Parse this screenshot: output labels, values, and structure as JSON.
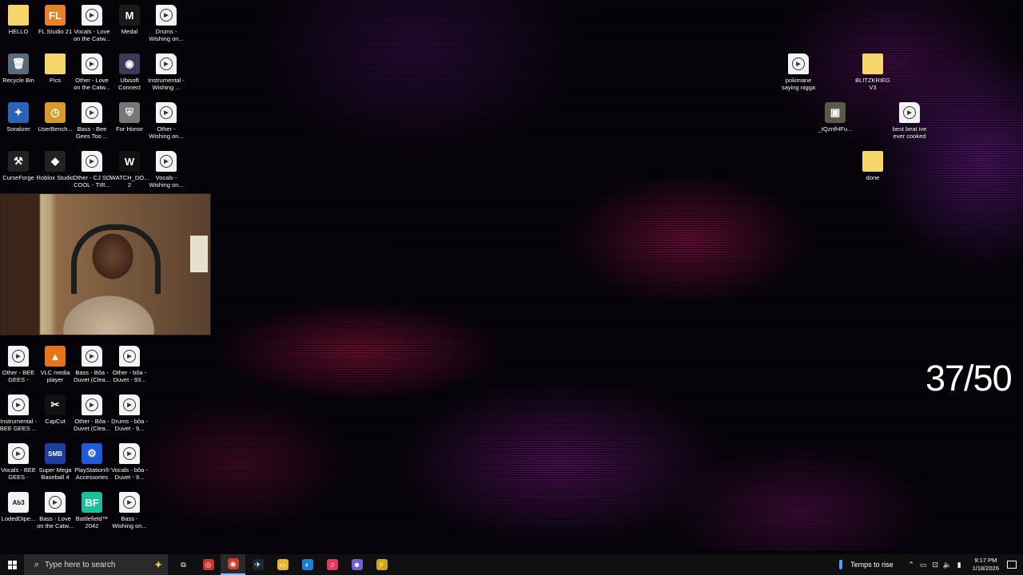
{
  "desktop_icons": [
    {
      "label": "HELLO",
      "kind": "folder",
      "icon": "folder-icon",
      "glyph": ""
    },
    {
      "label": "FL Studio 21",
      "kind": "app",
      "icon": "fl-studio-icon",
      "glyph": "FL",
      "color": "#e8822a"
    },
    {
      "label": "Vocals - Love on the Catw...",
      "kind": "media",
      "icon": "media-file-icon",
      "glyph": "▶"
    },
    {
      "label": "Medal",
      "kind": "app",
      "icon": "medal-icon",
      "glyph": "M",
      "color": "#1a1a1a"
    },
    {
      "label": "Drums - Wishing on...",
      "kind": "media",
      "icon": "media-file-icon",
      "glyph": "▶"
    },
    {
      "label": "Recycle Bin",
      "kind": "app",
      "icon": "recycle-bin-icon",
      "glyph": "🗑",
      "color": "#5a6b7d"
    },
    {
      "label": "Pics",
      "kind": "folder",
      "icon": "folder-icon",
      "glyph": ""
    },
    {
      "label": "Other - Love on the Catw...",
      "kind": "media",
      "icon": "media-file-icon",
      "glyph": "▶"
    },
    {
      "label": "Ubisoft Connect",
      "kind": "app",
      "icon": "ubisoft-icon",
      "glyph": "◉",
      "color": "#3a3a5a"
    },
    {
      "label": "Instrumental - Wishing ...",
      "kind": "media",
      "icon": "media-file-icon",
      "glyph": "▶"
    },
    {
      "label": "Soralizer",
      "kind": "app",
      "icon": "soralizer-icon",
      "glyph": "✦",
      "color": "#2a63b8"
    },
    {
      "label": "UserBench...",
      "kind": "app",
      "icon": "userbenchmark-icon",
      "glyph": "◷",
      "color": "#d89a2b"
    },
    {
      "label": "Bass - Bee Gees Too ...",
      "kind": "media",
      "icon": "media-file-icon",
      "glyph": "▶"
    },
    {
      "label": "For Honor",
      "kind": "app",
      "icon": "for-honor-icon",
      "glyph": "⛨",
      "color": "#777"
    },
    {
      "label": "Other - Wishing on...",
      "kind": "media",
      "icon": "media-file-icon",
      "glyph": "▶"
    },
    {
      "label": "CurseForge",
      "kind": "app",
      "icon": "curseforge-icon",
      "glyph": "⚒",
      "color": "#222"
    },
    {
      "label": "Roblox Studio",
      "kind": "app",
      "icon": "roblox-studio-icon",
      "glyph": "◆",
      "color": "#222"
    },
    {
      "label": "Other - CJ SO COOL - TIR...",
      "kind": "media",
      "icon": "media-file-icon",
      "glyph": "▶"
    },
    {
      "label": "WATCH_DO... 2",
      "kind": "app",
      "icon": "watch-dogs-icon",
      "glyph": "W",
      "color": "#111"
    },
    {
      "label": "Vocals - Wishing on...",
      "kind": "media",
      "icon": "media-file-icon",
      "glyph": "▶"
    },
    {
      "label": "Other - BEE GEES - TOO...",
      "kind": "media",
      "icon": "media-file-icon",
      "glyph": "▶"
    },
    {
      "label": "VLC media player",
      "kind": "app",
      "icon": "vlc-icon",
      "glyph": "▲",
      "color": "#e8741a"
    },
    {
      "label": "Bass - Bôa - Duvet (Clea...",
      "kind": "media",
      "icon": "media-file-icon",
      "glyph": "▶"
    },
    {
      "label": "Other - bôa - Duvet - 93...",
      "kind": "media",
      "icon": "media-file-icon",
      "glyph": "▶"
    },
    {
      "label": "Instrumental - BEE GEES ...",
      "kind": "media",
      "icon": "media-file-icon",
      "glyph": "▶"
    },
    {
      "label": "CapCut",
      "kind": "app",
      "icon": "capcut-icon",
      "glyph": "✂",
      "color": "#111"
    },
    {
      "label": "Other - Bôa - Duvet (Clea...",
      "kind": "media",
      "icon": "media-file-icon",
      "glyph": "▶"
    },
    {
      "label": "Drums - bôa - Duvet - 9...",
      "kind": "media",
      "icon": "media-file-icon",
      "glyph": "▶"
    },
    {
      "label": "Vocals - BEE GEES - TOO...",
      "kind": "media",
      "icon": "media-file-icon",
      "glyph": "▶"
    },
    {
      "label": "Super Mega Baseball 4",
      "kind": "app",
      "icon": "super-mega-baseball-icon",
      "glyph": "SMB",
      "color": "#1c3fa0"
    },
    {
      "label": "PlayStation® Accessories",
      "kind": "app",
      "icon": "playstation-icon",
      "glyph": "⚙",
      "color": "#1f5bd8"
    },
    {
      "label": "Vocals - bôa - Duvet - 9...",
      "kind": "media",
      "icon": "media-file-icon",
      "glyph": "▶"
    },
    {
      "label": "LodedDipe...",
      "kind": "app",
      "icon": "ableton-icon",
      "glyph": "Ab3",
      "color": "#f2f2f2"
    },
    {
      "label": "Bass - Love on the Catw...",
      "kind": "media",
      "icon": "media-file-icon",
      "glyph": "▶"
    },
    {
      "label": "Battlefield™ 2042",
      "kind": "app",
      "icon": "battlefield-icon",
      "glyph": "BF",
      "color": "#1bbf9a"
    },
    {
      "label": "Bass - Wishing on...",
      "kind": "media",
      "icon": "media-file-icon",
      "glyph": "▶"
    },
    {
      "label": "pokimane saying nigga",
      "kind": "media",
      "icon": "media-file-icon",
      "glyph": "▶"
    },
    {
      "label": "BLITZKRIEG V3",
      "kind": "folder",
      "icon": "folder-icon",
      "glyph": ""
    },
    {
      "label": "_tQznfHFu...",
      "kind": "app",
      "icon": "image-file-icon",
      "glyph": "▣",
      "color": "#5a5a4a"
    },
    {
      "label": "best beat ive ever cooked",
      "kind": "media",
      "icon": "media-file-icon",
      "glyph": "▶"
    },
    {
      "label": "done",
      "kind": "folder",
      "icon": "folder-icon",
      "glyph": ""
    }
  ],
  "overlay": {
    "counter": "37/50"
  },
  "taskbar": {
    "search_placeholder": "Type here to search",
    "apps": [
      {
        "name": "task-view",
        "glyph": "⧉",
        "color": "#101010"
      },
      {
        "name": "chrome-alt",
        "glyph": "◎",
        "color": "#c8332b"
      },
      {
        "name": "chrome",
        "glyph": "◉",
        "color": "#d33b2c",
        "active": true
      },
      {
        "name": "steam",
        "glyph": "✈",
        "color": "#1b2838"
      },
      {
        "name": "file-explorer",
        "glyph": "▭",
        "color": "#e7b431"
      },
      {
        "name": "edge",
        "glyph": "◐",
        "color": "#1c7fd6"
      },
      {
        "name": "itunes",
        "glyph": "♫",
        "color": "#e8365d"
      },
      {
        "name": "discord",
        "glyph": "☻",
        "color": "#6f62d8"
      },
      {
        "name": "cheat-engine",
        "glyph": "⚡",
        "color": "#caa52a"
      }
    ],
    "weather": "Temps to rise",
    "time": "9:17 PM",
    "date": "1/18/2026"
  }
}
